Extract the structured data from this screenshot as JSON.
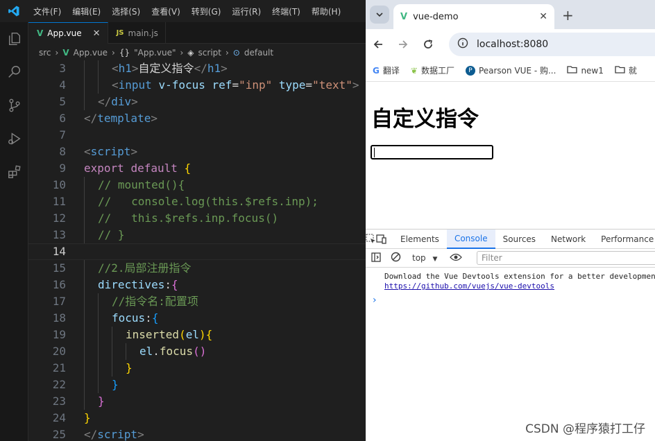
{
  "vscode": {
    "menu": [
      "文件(F)",
      "编辑(E)",
      "选择(S)",
      "查看(V)",
      "转到(G)",
      "运行(R)",
      "终端(T)",
      "帮助(H)"
    ],
    "tabs": [
      {
        "label": "App.vue",
        "icon": "vue-icon"
      },
      {
        "label": "main.js",
        "icon": "js-icon"
      }
    ],
    "breadcrumb": {
      "folder": "src",
      "file": "App.vue",
      "obj": "\"App.vue\"",
      "script": "script",
      "def": "default"
    }
  },
  "code_lines": [
    {
      "n": "3",
      "indent": 2,
      "segs": [
        [
          "c-tag",
          "<"
        ],
        [
          "c-tn",
          "h1"
        ],
        [
          "c-tag",
          ">"
        ],
        [
          "c-tx",
          "自定义指令"
        ],
        [
          "c-tag",
          "</"
        ],
        [
          "c-tn",
          "h1"
        ],
        [
          "c-tag",
          ">"
        ]
      ]
    },
    {
      "n": "4",
      "indent": 2,
      "segs": [
        [
          "c-tag",
          "<"
        ],
        [
          "c-tn",
          "input"
        ],
        [
          "c-tx",
          " "
        ],
        [
          "c-at",
          "v-focus"
        ],
        [
          "c-tx",
          " "
        ],
        [
          "c-at",
          "ref"
        ],
        [
          "c-tx",
          "="
        ],
        [
          "c-str",
          "\"inp\""
        ],
        [
          "c-tx",
          " "
        ],
        [
          "c-at",
          "type"
        ],
        [
          "c-tx",
          "="
        ],
        [
          "c-str",
          "\"text\""
        ],
        [
          "c-tag",
          ">"
        ]
      ]
    },
    {
      "n": "5",
      "indent": 1,
      "segs": [
        [
          "c-tag",
          "</"
        ],
        [
          "c-tn",
          "div"
        ],
        [
          "c-tag",
          ">"
        ]
      ]
    },
    {
      "n": "6",
      "indent": 0,
      "segs": [
        [
          "c-tag",
          "</"
        ],
        [
          "c-tn",
          "template"
        ],
        [
          "c-tag",
          ">"
        ]
      ]
    },
    {
      "n": "7",
      "indent": 0,
      "segs": []
    },
    {
      "n": "8",
      "indent": 0,
      "segs": [
        [
          "c-tag",
          "<"
        ],
        [
          "c-tn",
          "script"
        ],
        [
          "c-tag",
          ">"
        ]
      ]
    },
    {
      "n": "9",
      "indent": 0,
      "segs": [
        [
          "c-kw",
          "export"
        ],
        [
          "c-tx",
          " "
        ],
        [
          "c-kw",
          "default"
        ],
        [
          "c-tx",
          " "
        ],
        [
          "b1",
          "{"
        ]
      ]
    },
    {
      "n": "10",
      "indent": 1,
      "segs": [
        [
          "c-cm",
          "// mounted(){"
        ]
      ]
    },
    {
      "n": "11",
      "indent": 1,
      "segs": [
        [
          "c-cm",
          "//   console.log(this.$refs.inp);"
        ]
      ]
    },
    {
      "n": "12",
      "indent": 1,
      "segs": [
        [
          "c-cm",
          "//   this.$refs.inp.focus()"
        ]
      ]
    },
    {
      "n": "13",
      "indent": 1,
      "segs": [
        [
          "c-cm",
          "// }"
        ]
      ]
    },
    {
      "n": "14",
      "indent": 0,
      "cur": true,
      "segs": []
    },
    {
      "n": "15",
      "indent": 1,
      "segs": [
        [
          "c-cm",
          "//2.局部注册指令"
        ]
      ]
    },
    {
      "n": "16",
      "indent": 1,
      "segs": [
        [
          "c-pr",
          "directives"
        ],
        [
          "c-tx",
          ":"
        ],
        [
          "b2",
          "{"
        ]
      ]
    },
    {
      "n": "17",
      "indent": 2,
      "segs": [
        [
          "c-cm",
          "//指令名:配置项"
        ]
      ]
    },
    {
      "n": "18",
      "indent": 2,
      "segs": [
        [
          "c-pr",
          "focus"
        ],
        [
          "c-tx",
          ":"
        ],
        [
          "b3",
          "{"
        ]
      ]
    },
    {
      "n": "19",
      "indent": 3,
      "segs": [
        [
          "c-fn",
          "inserted"
        ],
        [
          "b1",
          "("
        ],
        [
          "c-pr",
          "el"
        ],
        [
          "b1",
          ")"
        ],
        [
          "b1",
          "{"
        ]
      ]
    },
    {
      "n": "20",
      "indent": 4,
      "segs": [
        [
          "c-pr",
          "el"
        ],
        [
          "c-tx",
          "."
        ],
        [
          "c-fn",
          "focus"
        ],
        [
          "b2",
          "()"
        ]
      ]
    },
    {
      "n": "21",
      "indent": 3,
      "segs": [
        [
          "b1",
          "}"
        ]
      ]
    },
    {
      "n": "22",
      "indent": 2,
      "segs": [
        [
          "b3",
          "}"
        ]
      ]
    },
    {
      "n": "23",
      "indent": 1,
      "segs": [
        [
          "b2",
          "}"
        ]
      ]
    },
    {
      "n": "24",
      "indent": 0,
      "segs": [
        [
          "b1",
          "}"
        ]
      ]
    },
    {
      "n": "25",
      "indent": 0,
      "segs": [
        [
          "c-tag",
          "</"
        ],
        [
          "c-tn",
          "script"
        ],
        [
          "c-tag",
          ">"
        ]
      ]
    }
  ],
  "chrome": {
    "tab_title": "vue-demo",
    "url": "localhost:8080",
    "bookmarks": [
      "翻译",
      "数据工厂",
      "Pearson VUE - 购...",
      "new1",
      "就"
    ],
    "page_heading": "自定义指令"
  },
  "devtools": {
    "tabs": [
      "Elements",
      "Console",
      "Sources",
      "Network",
      "Performance"
    ],
    "context": "top",
    "filter_placeholder": "Filter",
    "message": "Download the Vue Devtools extension for a better development",
    "link": "https://github.com/vuejs/vue-devtools",
    "prompt": "›"
  },
  "watermark": "CSDN @程序猿打工仔",
  "colors": {
    "vscode_bg": "#1f1f1f",
    "accent": "#0078d4",
    "vue_green": "#41b883",
    "devtools_active": "#1a73e8"
  }
}
